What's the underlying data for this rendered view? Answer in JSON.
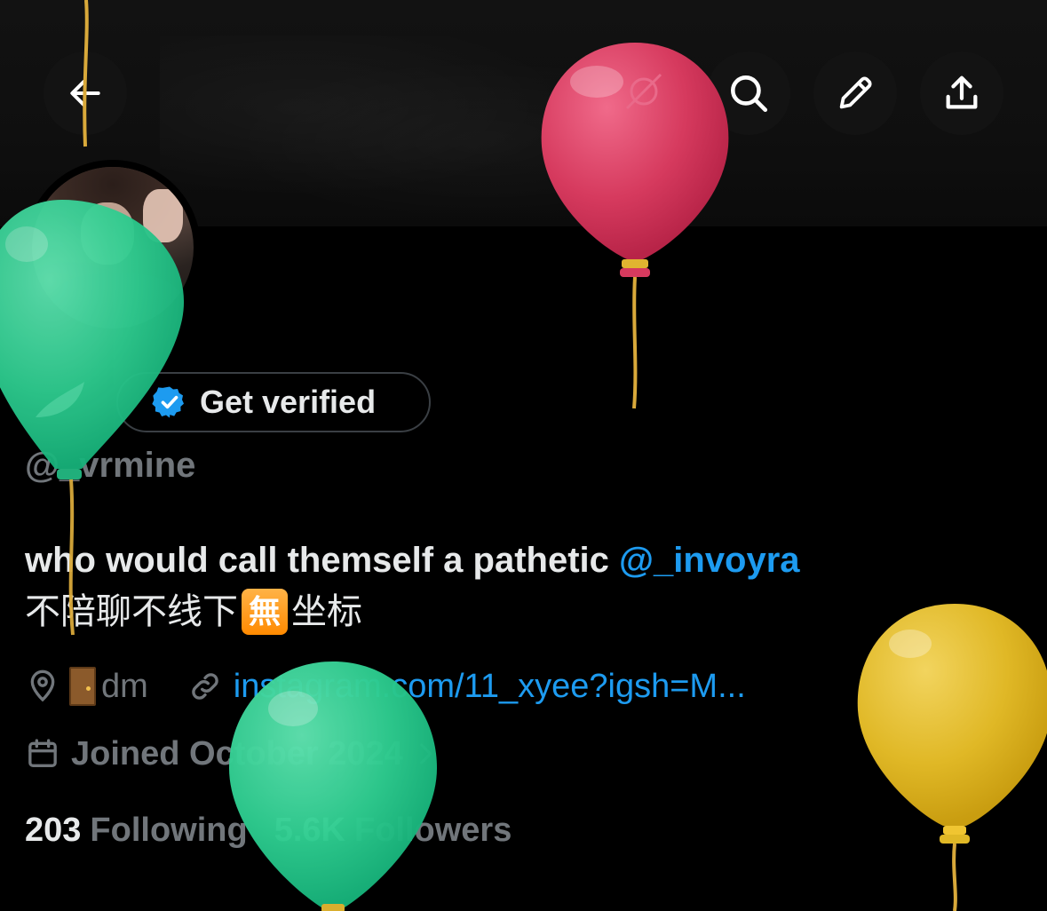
{
  "header": {
    "back_icon": "arrow-left-icon",
    "actions": [
      {
        "name": "search",
        "icon": "search-icon"
      },
      {
        "name": "edit",
        "icon": "pencil-icon"
      },
      {
        "name": "share",
        "icon": "share-upload-icon"
      }
    ]
  },
  "profile": {
    "get_verified_label": "Get verified",
    "handle": "@_vrmine",
    "bio_line1_text": "who would call themself a pathetic ",
    "bio_mention": "@_invoyra",
    "bio_line2_part1": "不陪聊不线下",
    "bio_emoji": "無",
    "bio_line2_part2": "坐标",
    "location": "dm",
    "website": "instagram.com/11_xyee?igsh=M...",
    "joined": "Joined October 2024",
    "following_count": "203",
    "following_label": "Following",
    "followers_count": "5.6K",
    "followers_label": "Followers"
  },
  "colors": {
    "accent": "#1d9bf0",
    "muted": "#71767b",
    "text": "#e7e9ea",
    "background": "#000000",
    "balloon_red": "#d63a5e",
    "balloon_green": "#2ecc8f",
    "balloon_yellow": "#e0b826"
  }
}
